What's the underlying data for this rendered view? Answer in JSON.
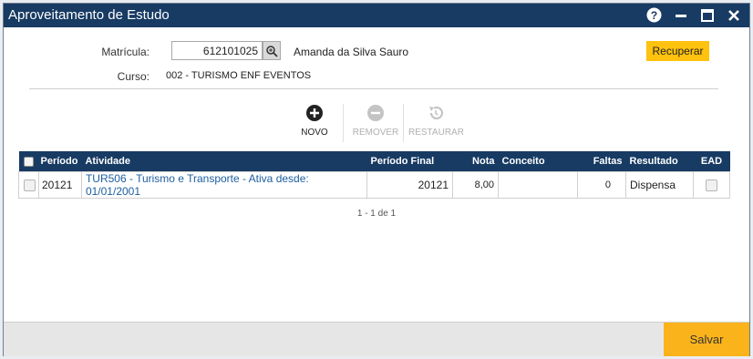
{
  "window": {
    "title": "Aproveitamento de Estudo",
    "controls": [
      "help-icon",
      "minimize-icon",
      "maximize-icon",
      "close-icon"
    ]
  },
  "form": {
    "matricula_label": "Matrícula:",
    "matricula_value": "612101025",
    "student_name": "Amanda da Silva Sauro",
    "curso_label": "Curso:",
    "curso_value": "002 - TURISMO ENF EVENTOS",
    "recuperar_label": "Recuperar"
  },
  "toolbar": {
    "novo": "NOVO",
    "remover": "REMOVER",
    "restaurar": "RESTAURAR"
  },
  "table": {
    "headers": {
      "periodo": "Período",
      "atividade": "Atividade",
      "periodo_final": "Período Final",
      "nota": "Nota",
      "conceito": "Conceito",
      "faltas": "Faltas",
      "resultado": "Resultado",
      "ead": "EAD"
    },
    "rows": [
      {
        "periodo": "20121",
        "atividade": "TUR506 - Turismo e Transporte - Ativa desde: 01/01/2001",
        "periodo_final": "20121",
        "nota": "8,00",
        "conceito": "",
        "faltas": "0",
        "resultado": "Dispensa",
        "ead": false
      }
    ]
  },
  "pager": {
    "text": "1 - 1 de 1"
  },
  "footer": {
    "salvar_label": "Salvar"
  },
  "colors": {
    "titlebar": "#173b63",
    "table_header": "#173b63",
    "accent_button": "#ffc20e",
    "save_button": "#fbb31c",
    "link": "#1d5fa0"
  }
}
